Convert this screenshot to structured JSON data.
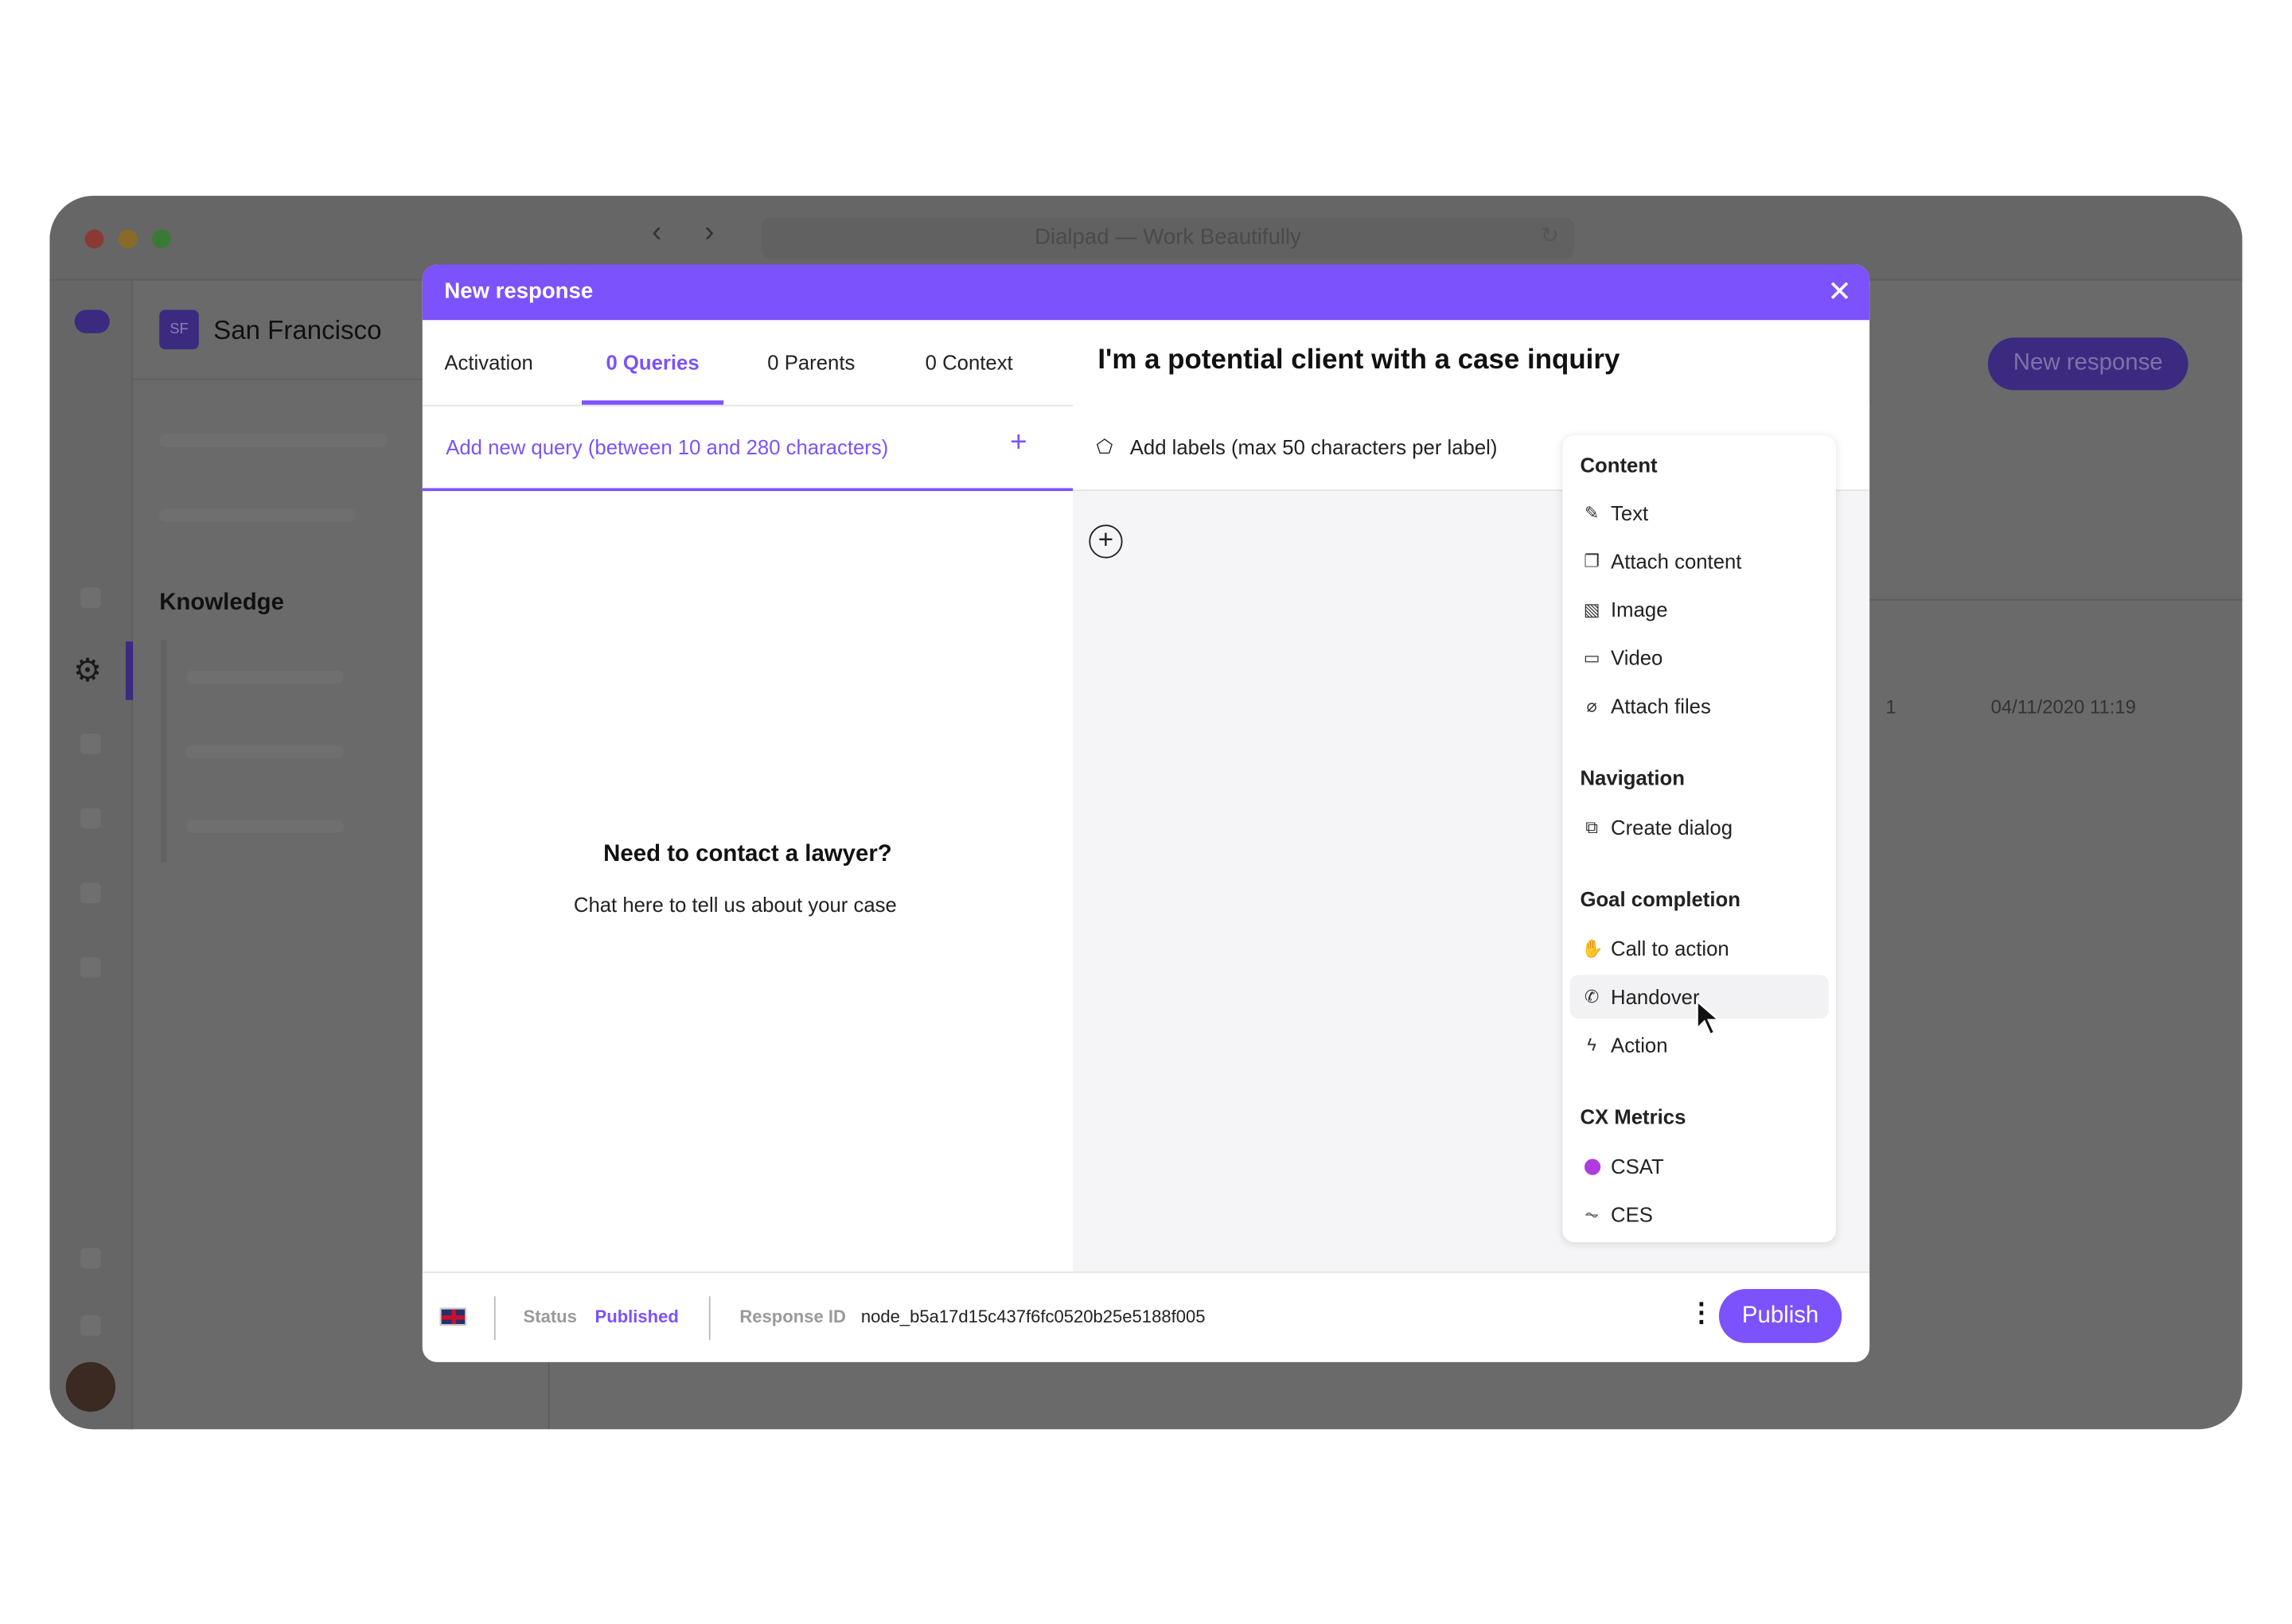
{
  "browser": {
    "title": "Dialpad — Work Beautifully"
  },
  "app": {
    "workspace_badge": "SF",
    "workspace_name": "San Francisco",
    "section": "Knowledge",
    "bg_button": "New response",
    "bg_row": {
      "count": "1",
      "date": "04/11/2020 11:19"
    }
  },
  "modal": {
    "title": "New response",
    "tabs": [
      {
        "label": "Activation"
      },
      {
        "label": "0 Queries",
        "active": true
      },
      {
        "label": "0 Parents"
      },
      {
        "label": "0 Context"
      }
    ],
    "response_title": "I'm a potential client with a case inquiry",
    "query_placeholder": "Add new query (between 10 and 280 characters)",
    "labels_placeholder": "Add labels (max 50 characters per label)",
    "preview": {
      "heading": "Need to contact a lawyer?",
      "text": "Chat here to tell us about your case"
    },
    "menu": {
      "sections": [
        {
          "title": "Content",
          "items": [
            {
              "label": "Text",
              "icon": "edit-icon"
            },
            {
              "label": "Attach content",
              "icon": "copy-icon"
            },
            {
              "label": "Image",
              "icon": "image-icon"
            },
            {
              "label": "Video",
              "icon": "video-icon"
            },
            {
              "label": "Attach files",
              "icon": "paperclip-icon"
            }
          ]
        },
        {
          "title": "Navigation",
          "items": [
            {
              "label": "Create dialog",
              "icon": "dialog-icon"
            }
          ]
        },
        {
          "title": "Goal completion",
          "items": [
            {
              "label": "Call to action",
              "icon": "hand-icon"
            },
            {
              "label": "Handover",
              "icon": "phone-icon",
              "hovered": true
            },
            {
              "label": "Action",
              "icon": "lightning-icon"
            }
          ]
        },
        {
          "title": "CX Metrics",
          "items": [
            {
              "label": "CSAT",
              "icon": "csat-icon"
            },
            {
              "label": "CES",
              "icon": "ces-icon"
            }
          ]
        }
      ]
    },
    "footer": {
      "status_label": "Status",
      "status_value": "Published",
      "id_label": "Response ID",
      "id_value": "node_b5a17d15c437f6fc0520b25e5188f005",
      "publish": "Publish"
    }
  },
  "colors": {
    "accent": "#7c52fc",
    "overlay": "#666666"
  }
}
